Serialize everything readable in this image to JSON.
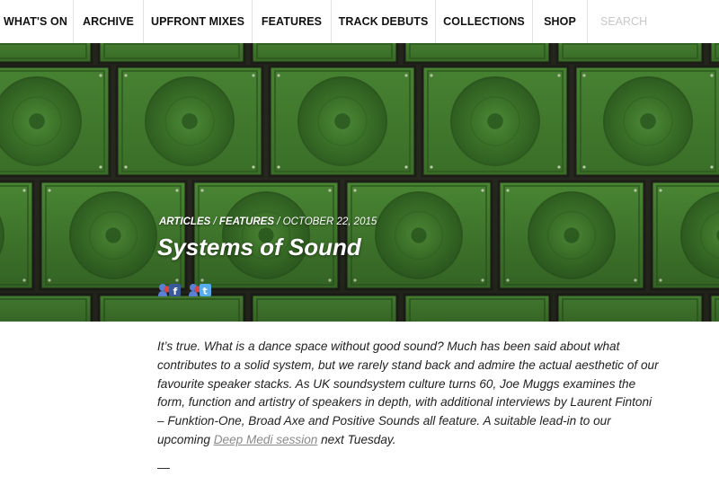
{
  "nav": {
    "items": [
      {
        "label": "WHAT'S ON"
      },
      {
        "label": "ARCHIVE"
      },
      {
        "label": "UPFRONT MIXES"
      },
      {
        "label": "FEATURES"
      },
      {
        "label": "TRACK DEBUTS"
      },
      {
        "label": "COLLECTIONS"
      },
      {
        "label": "SHOP"
      }
    ],
    "search_placeholder": "SEARCH"
  },
  "article": {
    "category_1": "ARTICLES",
    "category_2": "FEATURES",
    "separator": "/",
    "date": "OCTOBER 22, 2015",
    "title": "Systems of Sound",
    "share": [
      {
        "icon": "facebook-share-icon"
      },
      {
        "icon": "twitter-share-icon"
      }
    ],
    "intro_text": "It’s true. What is a dance space without good sound? Much has been said about what contributes to a solid system, but we rarely stand back and admire the actual aesthetic of our favourite speaker stacks. As UK soundsystem culture turns 60, Joe Muggs examines the form, function and artistry of speakers in depth, with additional interviews by Laurent Fintoni – Funktion-One, Broad Axe and Positive Sounds all feature. A suitable lead-in to our upcoming",
    "intro_link": "Deep Medi session",
    "intro_end": "next Tuesday.",
    "dash": "—"
  },
  "colors": {
    "speaker_green": "#3f7a2c",
    "hero_dark": "#26281f",
    "link_gray": "#8a8a8a",
    "facebook_blue": "#3b5998",
    "twitter_blue": "#55acee"
  }
}
